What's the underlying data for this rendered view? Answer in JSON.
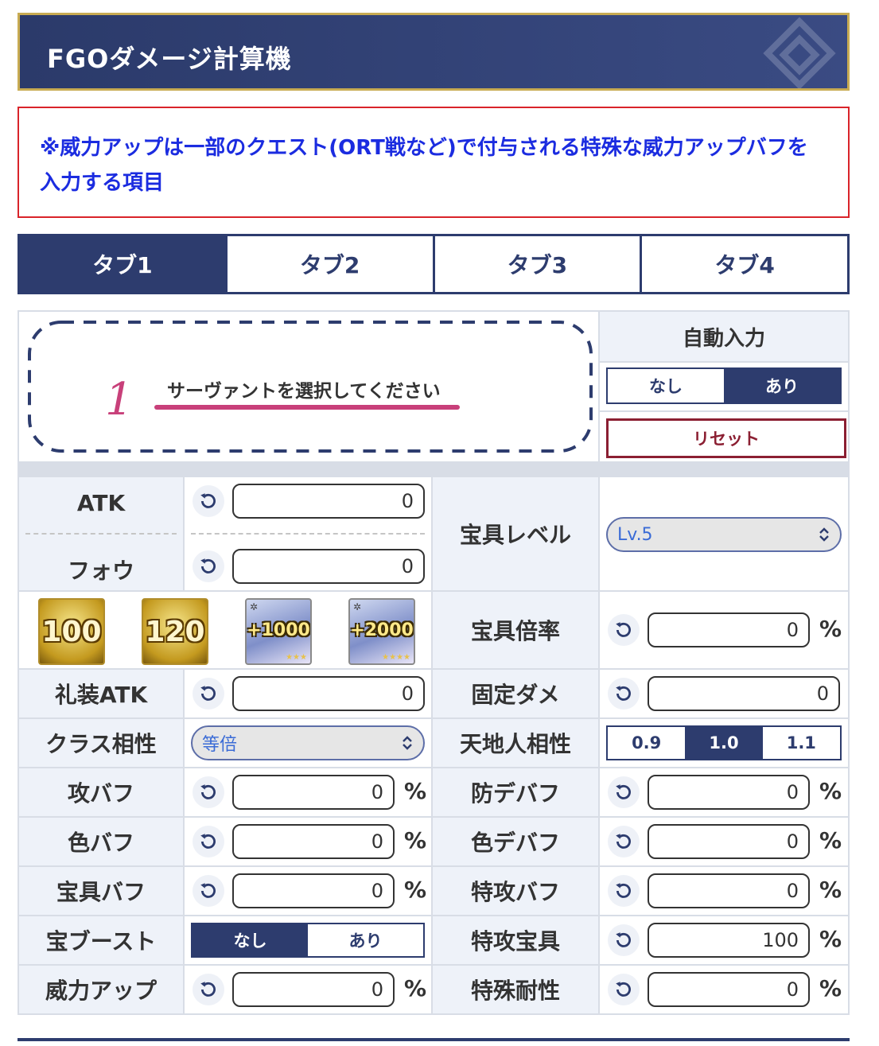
{
  "header": {
    "title": "FGOダメージ計算機"
  },
  "notice": {
    "text": "※威力アップは一部のクエスト(ORT戦など)で付与される特殊な威力アップバフを入力する項目"
  },
  "tabs": [
    {
      "label": "タブ1",
      "active": true
    },
    {
      "label": "タブ2",
      "active": false
    },
    {
      "label": "タブ3",
      "active": false
    },
    {
      "label": "タブ4",
      "active": false
    }
  ],
  "servant": {
    "number": "1",
    "prompt": "サーヴァントを選択してください"
  },
  "auto_input": {
    "label": "自動入力",
    "options": [
      "なし",
      "あり"
    ],
    "selected": "あり",
    "reset_label": "リセット"
  },
  "fields": {
    "atk": {
      "label": "ATK",
      "value": "0"
    },
    "fou": {
      "label": "フォウ",
      "value": "0"
    },
    "np_level": {
      "label": "宝具レベル",
      "selected": "Lv.5"
    },
    "np_multiplier": {
      "label": "宝具倍率",
      "value": "0",
      "unit": "%"
    },
    "ce_atk": {
      "label": "礼装ATK",
      "value": "0"
    },
    "fixed_damage": {
      "label": "固定ダメ",
      "value": "0"
    },
    "class_affinity": {
      "label": "クラス相性",
      "selected": "等倍"
    },
    "attribute_affinity": {
      "label": "天地人相性",
      "options": [
        "0.9",
        "1.0",
        "1.1"
      ],
      "selected": "1.0"
    },
    "atk_buff": {
      "label": "攻バフ",
      "value": "0",
      "unit": "%"
    },
    "def_debuff": {
      "label": "防デバフ",
      "value": "0",
      "unit": "%"
    },
    "color_buff": {
      "label": "色バフ",
      "value": "0",
      "unit": "%"
    },
    "color_debuff": {
      "label": "色デバフ",
      "value": "0",
      "unit": "%"
    },
    "np_buff": {
      "label": "宝具バフ",
      "value": "0",
      "unit": "%"
    },
    "special_atk_buff": {
      "label": "特攻バフ",
      "value": "0",
      "unit": "%"
    },
    "np_boost": {
      "label": "宝ブースト",
      "options": [
        "なし",
        "あり"
      ],
      "selected": "なし"
    },
    "special_np": {
      "label": "特攻宝具",
      "value": "100",
      "unit": "%"
    },
    "power_up": {
      "label": "威力アップ",
      "value": "0",
      "unit": "%"
    },
    "special_resist": {
      "label": "特殊耐性",
      "value": "0",
      "unit": "%"
    }
  },
  "items": [
    {
      "name": "grail-100-icon",
      "label": "100"
    },
    {
      "name": "grail-120-icon",
      "label": "120"
    },
    {
      "name": "fou-1000-icon",
      "label": "+1000"
    },
    {
      "name": "fou-2000-icon",
      "label": "+2000"
    }
  ],
  "colors": {
    "navy": "#2d3c6e",
    "gold": "#c8ab52",
    "red": "#d9242a",
    "notice_blue": "#1b2ce0",
    "reset_red": "#8b1f32",
    "pink": "#c8407a"
  }
}
